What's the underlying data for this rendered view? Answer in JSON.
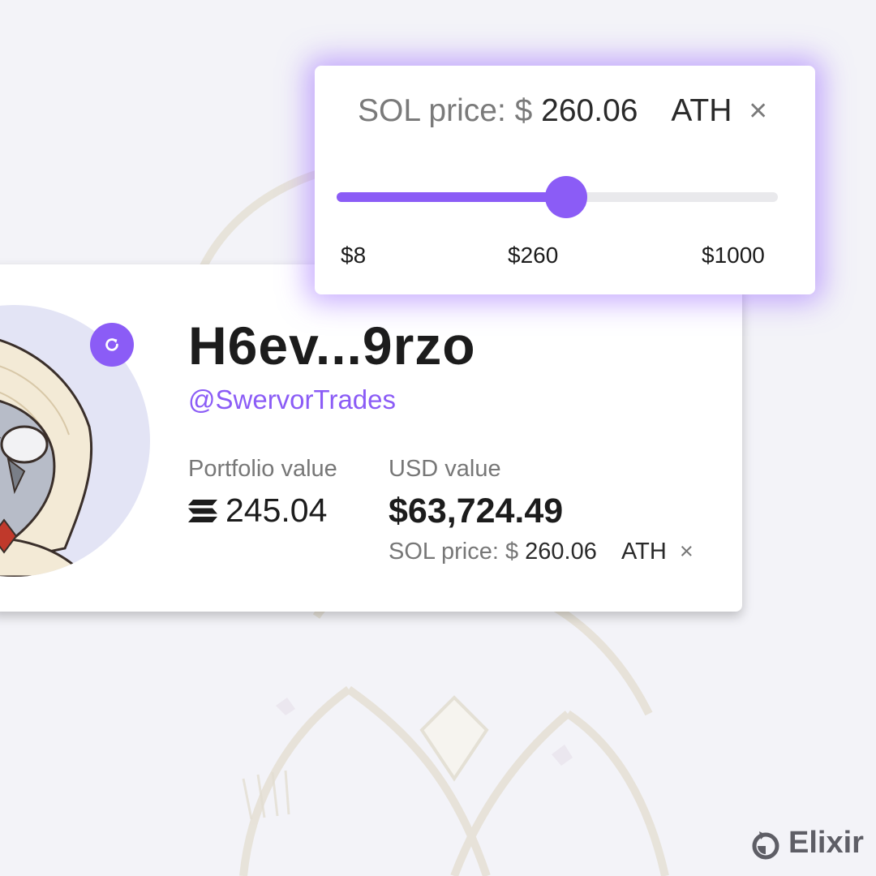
{
  "profile": {
    "wallet_name": "H6ev...9rzo",
    "handle": "@SwervorTrades",
    "portfolio_label": "Portfolio value",
    "portfolio_value": "245.04",
    "usd_label": "USD value",
    "usd_value": "$63,724.49",
    "price_prefix": "SOL price: $",
    "price_value": "260.06",
    "ath_label": "ATH",
    "close_glyph": "×"
  },
  "price_popup": {
    "price_prefix": "SOL price: $",
    "price_value": "260.06",
    "ath_label": "ATH",
    "close_glyph": "×",
    "slider": {
      "min_label": "$8",
      "mid_label": "$260",
      "max_label": "$1000",
      "fill_fraction": 0.52
    }
  },
  "brand": {
    "name": "Elixir"
  },
  "colors": {
    "accent": "#8b5cf6",
    "background": "#f3f3f8",
    "avatar_bg": "#e3e4f5"
  },
  "icons": {
    "refresh": "refresh-icon",
    "sol": "sol-icon",
    "logo": "elixir-logo-icon"
  }
}
